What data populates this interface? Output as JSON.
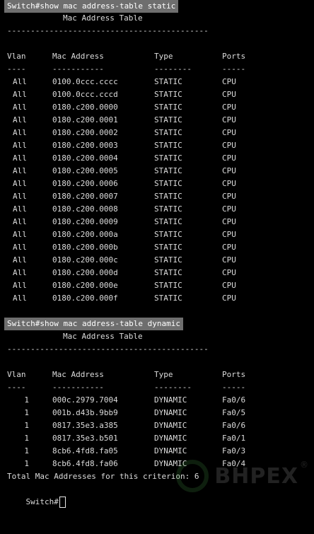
{
  "static_section": {
    "command": "Switch#show mac address-table static",
    "title": "Mac Address Table",
    "separator": "-------------------------------------------",
    "headers": {
      "vlan": "Vlan",
      "mac": "Mac Address",
      "type": "Type",
      "ports": "Ports"
    },
    "underlines": {
      "vlan": "----",
      "mac": "-----------",
      "type": "--------",
      "ports": "-----"
    },
    "rows": [
      {
        "vlan": "All",
        "mac": "0100.0ccc.cccc",
        "type": "STATIC",
        "ports": "CPU"
      },
      {
        "vlan": "All",
        "mac": "0100.0ccc.cccd",
        "type": "STATIC",
        "ports": "CPU"
      },
      {
        "vlan": "All",
        "mac": "0180.c200.0000",
        "type": "STATIC",
        "ports": "CPU"
      },
      {
        "vlan": "All",
        "mac": "0180.c200.0001",
        "type": "STATIC",
        "ports": "CPU"
      },
      {
        "vlan": "All",
        "mac": "0180.c200.0002",
        "type": "STATIC",
        "ports": "CPU"
      },
      {
        "vlan": "All",
        "mac": "0180.c200.0003",
        "type": "STATIC",
        "ports": "CPU"
      },
      {
        "vlan": "All",
        "mac": "0180.c200.0004",
        "type": "STATIC",
        "ports": "CPU"
      },
      {
        "vlan": "All",
        "mac": "0180.c200.0005",
        "type": "STATIC",
        "ports": "CPU"
      },
      {
        "vlan": "All",
        "mac": "0180.c200.0006",
        "type": "STATIC",
        "ports": "CPU"
      },
      {
        "vlan": "All",
        "mac": "0180.c200.0007",
        "type": "STATIC",
        "ports": "CPU"
      },
      {
        "vlan": "All",
        "mac": "0180.c200.0008",
        "type": "STATIC",
        "ports": "CPU"
      },
      {
        "vlan": "All",
        "mac": "0180.c200.0009",
        "type": "STATIC",
        "ports": "CPU"
      },
      {
        "vlan": "All",
        "mac": "0180.c200.000a",
        "type": "STATIC",
        "ports": "CPU"
      },
      {
        "vlan": "All",
        "mac": "0180.c200.000b",
        "type": "STATIC",
        "ports": "CPU"
      },
      {
        "vlan": "All",
        "mac": "0180.c200.000c",
        "type": "STATIC",
        "ports": "CPU"
      },
      {
        "vlan": "All",
        "mac": "0180.c200.000d",
        "type": "STATIC",
        "ports": "CPU"
      },
      {
        "vlan": "All",
        "mac": "0180.c200.000e",
        "type": "STATIC",
        "ports": "CPU"
      },
      {
        "vlan": "All",
        "mac": "0180.c200.000f",
        "type": "STATIC",
        "ports": "CPU"
      }
    ]
  },
  "dynamic_section": {
    "command": "Switch#show mac address-table dynamic",
    "title": "Mac Address Table",
    "separator": "-------------------------------------------",
    "headers": {
      "vlan": "Vlan",
      "mac": "Mac Address",
      "type": "Type",
      "ports": "Ports"
    },
    "underlines": {
      "vlan": "----",
      "mac": "-----------",
      "type": "--------",
      "ports": "-----"
    },
    "rows": [
      {
        "vlan": "1",
        "mac": "000c.2979.7004",
        "type": "DYNAMIC",
        "ports": "Fa0/6"
      },
      {
        "vlan": "1",
        "mac": "001b.d43b.9bb9",
        "type": "DYNAMIC",
        "ports": "Fa0/5"
      },
      {
        "vlan": "1",
        "mac": "0817.35e3.a385",
        "type": "DYNAMIC",
        "ports": "Fa0/6"
      },
      {
        "vlan": "1",
        "mac": "0817.35e3.b501",
        "type": "DYNAMIC",
        "ports": "Fa0/1"
      },
      {
        "vlan": "1",
        "mac": "8cb6.4fd8.fa05",
        "type": "DYNAMIC",
        "ports": "Fa0/3"
      },
      {
        "vlan": "1",
        "mac": "8cb6.4fd8.fa06",
        "type": "DYNAMIC",
        "ports": "Fa0/4"
      }
    ],
    "total_line": "Total Mac Addresses for this criterion: 6"
  },
  "prompt": "Switch#",
  "watermark": {
    "text": "BHPEX",
    "registered_mark": "®"
  },
  "colors": {
    "background": "#000000",
    "text": "#dcdcdc",
    "command_highlight": "#6e6e6e"
  }
}
